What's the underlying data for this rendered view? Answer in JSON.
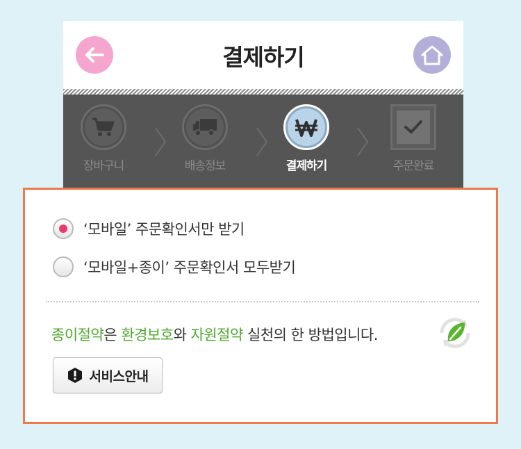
{
  "header": {
    "title": "결제하기"
  },
  "steps": [
    {
      "label": "장바구니",
      "icon": "cart-icon",
      "active": false
    },
    {
      "label": "배송정보",
      "icon": "truck-icon",
      "active": false
    },
    {
      "label": "결제하기",
      "icon": "won-icon",
      "active": true
    },
    {
      "label": "주문완료",
      "icon": "check-icon",
      "active": false
    }
  ],
  "options": [
    {
      "label": "‘모바일’ 주문확인서만 받기",
      "selected": true
    },
    {
      "label": "‘모바일+종이’ 주문확인서 모두받기",
      "selected": false
    }
  ],
  "eco": {
    "part1": "종이절약",
    "part2": "은 ",
    "part3": "환경보호",
    "part4": "와 ",
    "part5": "자원절약",
    "part6": " 실천의 한 방법입니다."
  },
  "service_button": {
    "label": "서비스안내"
  },
  "colors": {
    "accent_border": "#ee7a4a",
    "eco_green": "#4fa82e",
    "radio_selected": "#ee3a6a",
    "back_button": "#f4a6cf",
    "home_button": "#b2b0d8"
  }
}
